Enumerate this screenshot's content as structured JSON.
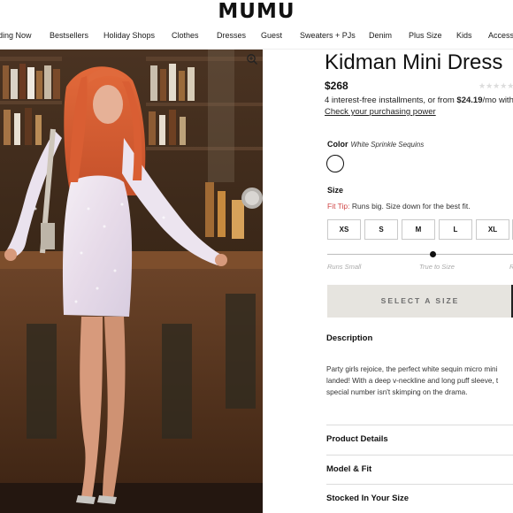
{
  "header": {
    "logo": "MUMU",
    "nav": [
      "ding Now",
      "Bestsellers",
      "Holiday Shops",
      "Clothes",
      "Dresses",
      "Guest",
      "Sweaters + PJs",
      "Denim",
      "Plus Size",
      "Kids",
      "Access"
    ]
  },
  "product": {
    "title": "Kidman Mini Dress",
    "price": "$268",
    "rating_stars": "★★★★★",
    "installments_prefix": "4 interest-free installments, or from ",
    "installments_amount": "$24.19",
    "installments_suffix": "/mo with s",
    "purchasing_link": "Check your purchasing power"
  },
  "color": {
    "label": "Color",
    "value": "White Sprinkle Sequins",
    "swatch_color": "#ffffff"
  },
  "size": {
    "label": "Size",
    "fit_tip_label": "Fit Tip:",
    "fit_tip_text": "Runs big. Size down for the best fit.",
    "options": [
      "XS",
      "S",
      "M",
      "L",
      "XL"
    ],
    "fit_scale": {
      "left": "Runs Small",
      "center": "True to Size",
      "right": "R",
      "value": 0.57
    },
    "select_button": "SELECT A SIZE"
  },
  "description": {
    "title": "Description",
    "lines": [
      "Party girls rejoice, the perfect white sequin micro mini",
      "landed! With a deep v-neckline and long puff sleeve, t",
      "special number isn't skimping on the drama."
    ]
  },
  "accordions": [
    "Product Details",
    "Model & Fit",
    "Stocked In Your Size"
  ],
  "colors": {
    "accent_red": "#d04747",
    "select_bg": "#e6e4df",
    "text": "#1a1a1a"
  }
}
